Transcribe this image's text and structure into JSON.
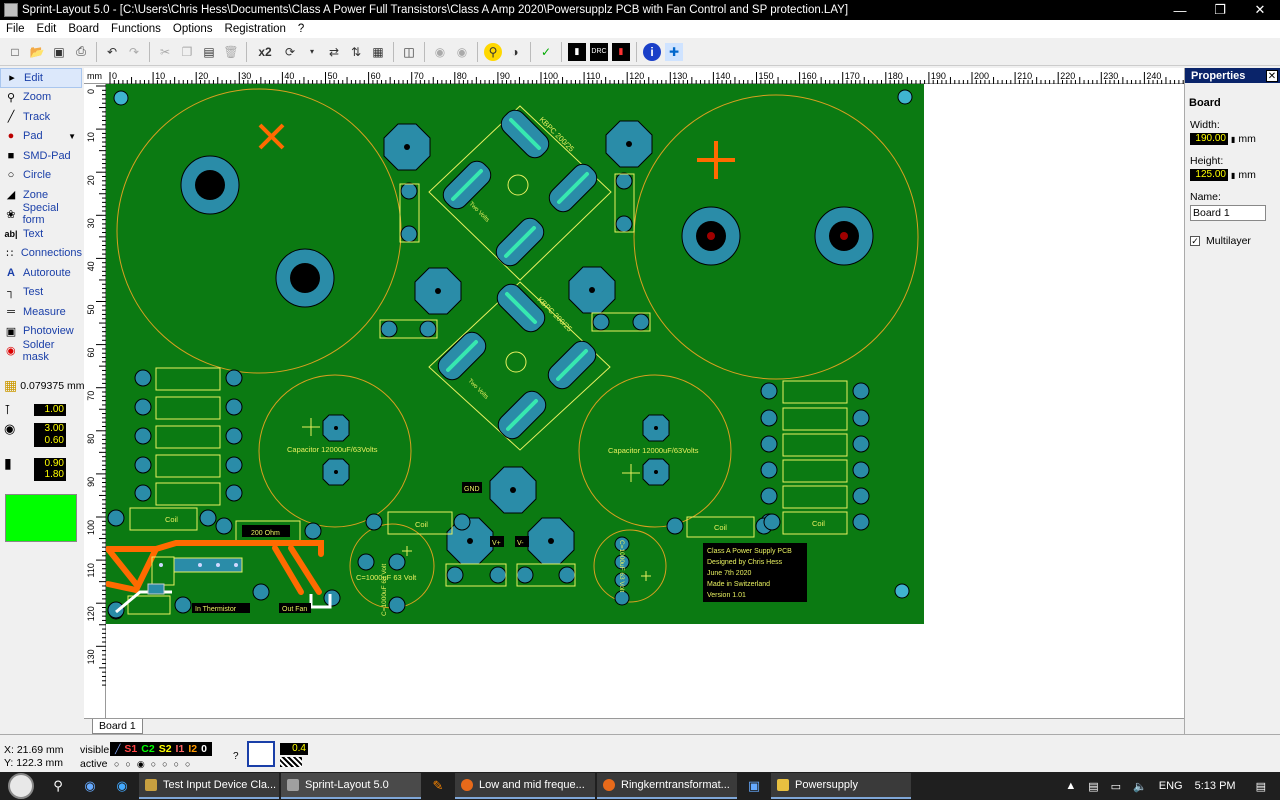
{
  "window": {
    "title": "Sprint-Layout 5.0 - [C:\\Users\\Chris Hess\\Documents\\Class A Power Full Transistors\\Class A Amp 2020\\Powersupplz PCB with Fan Control and SP protection.LAY]",
    "minimize": "—",
    "maximize": "❐",
    "close": "✕"
  },
  "menu": [
    "File",
    "Edit",
    "Board",
    "Functions",
    "Options",
    "Registration",
    "?"
  ],
  "toolbar": {
    "zoom_label": "x2"
  },
  "tools": [
    {
      "label": "Edit",
      "icon": "arrow-cursor-icon",
      "glyph": "▸",
      "active": true
    },
    {
      "label": "Zoom",
      "icon": "magnifier-icon",
      "glyph": "⚲"
    },
    {
      "label": "Track",
      "icon": "track-icon",
      "glyph": "╱"
    },
    {
      "label": "Pad",
      "icon": "pad-icon",
      "glyph": "●",
      "dropdown": true
    },
    {
      "label": "SMD-Pad",
      "icon": "smd-pad-icon",
      "glyph": "■"
    },
    {
      "label": "Circle",
      "icon": "circle-icon",
      "glyph": "○"
    },
    {
      "label": "Zone",
      "icon": "zone-icon",
      "glyph": "◢"
    },
    {
      "label": "Special form",
      "icon": "special-form-icon",
      "glyph": "❀"
    },
    {
      "label": "Text",
      "icon": "text-icon",
      "glyph": "ab|"
    },
    {
      "label": "Connections",
      "icon": "connections-icon",
      "glyph": "∷"
    },
    {
      "label": "Autoroute",
      "icon": "autoroute-icon",
      "glyph": "A"
    },
    {
      "label": "Test",
      "icon": "test-icon",
      "glyph": "┐"
    },
    {
      "label": "Measure",
      "icon": "measure-icon",
      "glyph": "═"
    },
    {
      "label": "Photoview",
      "icon": "camera-icon",
      "glyph": "▣"
    },
    {
      "label": "Solder mask",
      "icon": "solder-mask-icon",
      "glyph": "◉"
    }
  ],
  "grid": {
    "value": "0.079375 mm"
  },
  "params": {
    "track_width": "1.00",
    "pad_outer": "3.00",
    "pad_inner": "0.60",
    "smd_w": "0.90",
    "smd_h": "1.80"
  },
  "properties": {
    "title": "Properties",
    "section": "Board",
    "width_label": "Width:",
    "width_value": "190.00",
    "height_label": "Height:",
    "height_value": "125.00",
    "unit": "mm",
    "name_label": "Name:",
    "name_value": "Board 1",
    "multilayer_label": "Multilayer",
    "multilayer_checked": "✓"
  },
  "ruler": {
    "unit": "mm",
    "top_ticks": [
      "0",
      "10",
      "20",
      "30",
      "40",
      "50",
      "60",
      "70",
      "80",
      "90",
      "100",
      "110",
      "120",
      "130",
      "140",
      "150",
      "160",
      "170",
      "180",
      "190",
      "200",
      "210",
      "220",
      "230",
      "240"
    ],
    "left_ticks": [
      "0",
      "10",
      "20",
      "30",
      "40",
      "50",
      "60",
      "70",
      "80",
      "90",
      "100",
      "110",
      "120",
      "130"
    ]
  },
  "pcb": {
    "texts": {
      "cap_left": "Capacitor 12000uF/63Volts",
      "cap_right": "Capacitor 12000uF/63Volts",
      "cap_small_left": "C=1000uF 63 Volt",
      "cap_small_left_v": "C=1000uF 63 Volt",
      "cap_small_right_v": "C=1000uF 63 Volt",
      "bridge_top": "KBPC 200/25",
      "bridge_bottom": "KBPC 200/25",
      "two_volts_top": "Two Volts",
      "two_volts_bottom": "Two Volts",
      "gnd": "GND",
      "vplus": "V+",
      "vminus": "V-",
      "coil": "Coil",
      "res200": "200 Ohm",
      "thermistor": "In Thermistor",
      "outfan": "Out Fan",
      "info": [
        "Class A Power Supply PCB",
        "Designed by Chris Hess",
        "June 7th 2020",
        "Made in Switzerland",
        "Version 1.01"
      ]
    }
  },
  "tabs": [
    "Board 1"
  ],
  "status": {
    "x": "X:  21.69 mm",
    "y": "Y:  122.3 mm",
    "visible_label": "visible",
    "active_label": "active",
    "layers": [
      "S1",
      "C2",
      "S2",
      "I1",
      "I2",
      "0"
    ],
    "q": "?",
    "zoom_val": "0.4"
  },
  "taskbar": {
    "tasks": [
      {
        "label": "Test Input Device Cla...",
        "color": "#c8a040"
      },
      {
        "label": "Sprint-Layout 5.0",
        "color": "#a0a0a0"
      },
      {
        "label": "Low and mid freque...",
        "color": "#e86a1a"
      },
      {
        "label": "Ringkerntransformat...",
        "color": "#e86a1a"
      },
      {
        "label": "Powersupply",
        "color": "#e8c040"
      }
    ],
    "lang": "ENG",
    "time": "5:13 PM"
  },
  "colors": {
    "board": "#0b7a12",
    "pad": "#2a8ca8",
    "silk": "#e8f060",
    "track": "#ff6a00",
    "accent_green": "#00ff00"
  }
}
